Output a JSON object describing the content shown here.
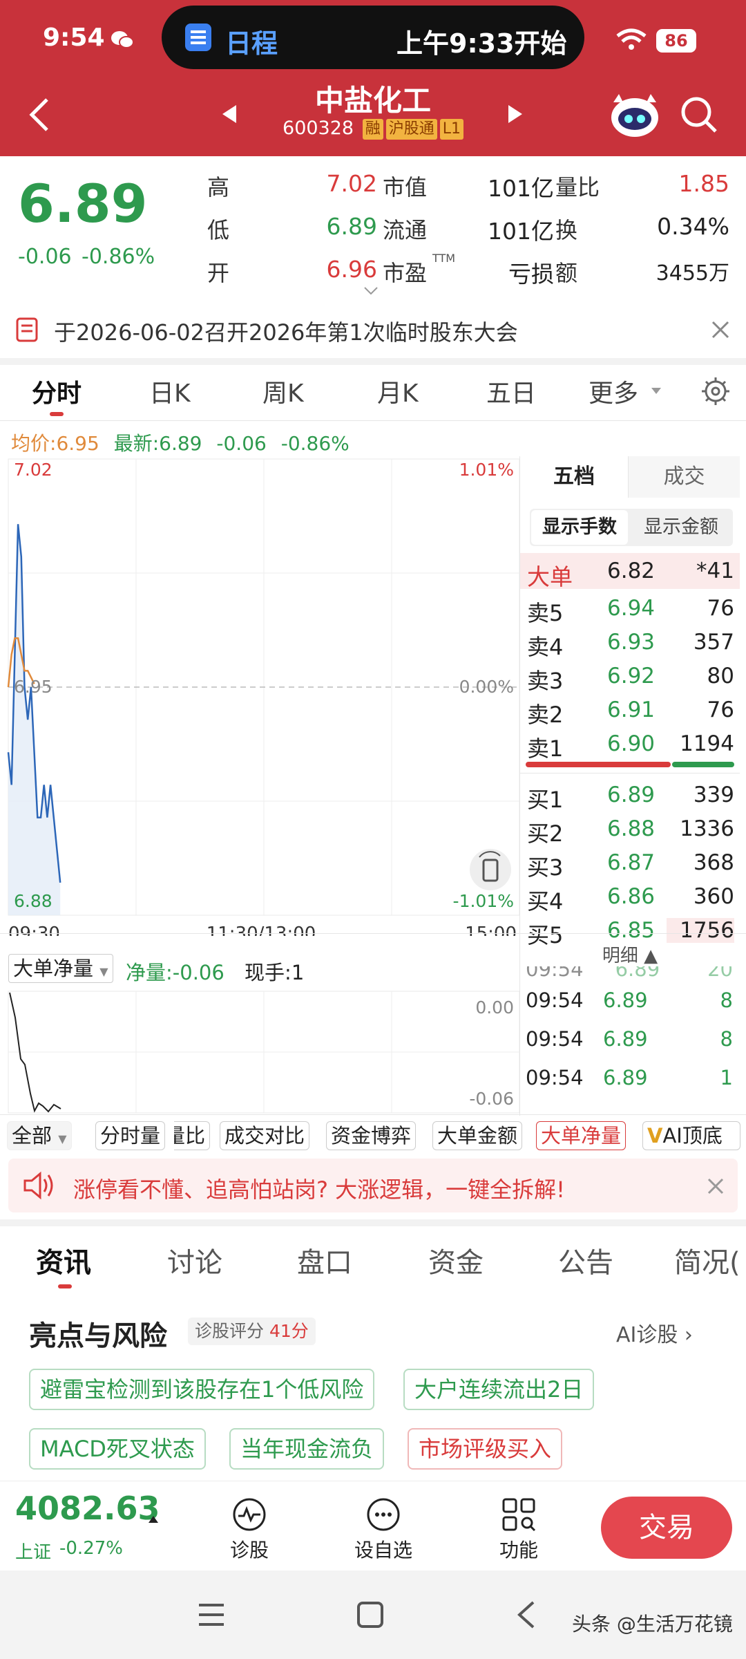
{
  "status_bar": {
    "time": "9:54",
    "island_label": "日程",
    "island_text": "上午9:33开始",
    "battery": "86"
  },
  "header": {
    "title": "中盐化工",
    "code": "600328",
    "tags": [
      "融",
      "沪股通",
      "L1"
    ]
  },
  "quote": {
    "price": "6.89",
    "change": "-0.06",
    "change_pct": "-0.86%",
    "rows": [
      {
        "l1": "高",
        "v1": "7.02",
        "l2": "市值",
        "v2": "101亿",
        "l3": "量比",
        "v3": "1.85"
      },
      {
        "l1": "低",
        "v1": "6.89",
        "l2": "流通",
        "v2": "101亿",
        "l3": "换",
        "v3": "0.34%"
      },
      {
        "l1": "开",
        "v1": "6.96",
        "l2": "市盈",
        "l2sup": "TTM",
        "v2": "亏损",
        "l3": "额",
        "v3": "3455万"
      }
    ]
  },
  "notice": {
    "text": "于2026-06-02召开2026年第1次临时股东大会"
  },
  "chart_tabs": [
    "分时",
    "日K",
    "周K",
    "月K",
    "五日",
    "更多"
  ],
  "chart_info": {
    "avg_label": "均价:",
    "avg": "6.95",
    "latest_label": "最新:",
    "latest": "6.89",
    "chg": "-0.06",
    "pct": "-0.86%"
  },
  "chart_data": {
    "type": "line",
    "y_top_label": "7.02",
    "y_mid_label": "6.95",
    "y_bottom_label": "6.88",
    "pct_top": "1.01%",
    "pct_mid": "0.00%",
    "pct_bottom": "-1.01%",
    "x_labels": [
      "09:30",
      "11:30/13:00",
      "15:00"
    ],
    "ylim": [
      6.88,
      7.02
    ],
    "series": [
      {
        "color": "#2c66b8",
        "values": [
          6.93,
          6.92,
          6.96,
          7.0,
          6.99,
          6.95,
          6.94,
          6.95,
          6.93,
          6.91,
          6.91,
          6.92,
          6.91,
          6.92,
          6.91,
          6.9,
          6.89
        ]
      },
      {
        "color": "#e08a3b",
        "values": [
          6.95,
          6.96,
          6.965,
          6.965,
          6.96,
          6.955,
          6.955,
          6.953,
          6.951
        ]
      }
    ]
  },
  "order_book": {
    "tabs": [
      "五档",
      "成交"
    ],
    "toggle": [
      "显示手数",
      "显示金额"
    ],
    "big": {
      "label": "大单",
      "price": "6.82",
      "vol": "*41"
    },
    "sells": [
      {
        "label": "卖5",
        "price": "6.94",
        "vol": "76"
      },
      {
        "label": "卖4",
        "price": "6.93",
        "vol": "357"
      },
      {
        "label": "卖3",
        "price": "6.92",
        "vol": "80"
      },
      {
        "label": "卖2",
        "price": "6.91",
        "vol": "76"
      },
      {
        "label": "卖1",
        "price": "6.90",
        "vol": "1194"
      }
    ],
    "buys": [
      {
        "label": "买1",
        "price": "6.89",
        "vol": "339"
      },
      {
        "label": "买2",
        "price": "6.88",
        "vol": "1336"
      },
      {
        "label": "买3",
        "price": "6.87",
        "vol": "368"
      },
      {
        "label": "买4",
        "price": "6.86",
        "vol": "360"
      },
      {
        "label": "买5",
        "price": "6.85",
        "vol": "1756"
      }
    ]
  },
  "sub_chart": {
    "select": "大单净量",
    "net_label": "净量:",
    "net": "-0.06",
    "hand_label": "现手:",
    "hand": "1",
    "top": "0.00",
    "bottom": "-0.06"
  },
  "detail": {
    "title": "明细",
    "rows": [
      {
        "t": "09:54",
        "p": "6.89",
        "v": "20"
      },
      {
        "t": "09:54",
        "p": "6.89",
        "v": "8"
      },
      {
        "t": "09:54",
        "p": "6.89",
        "v": "8"
      },
      {
        "t": "09:54",
        "p": "6.89",
        "v": "1"
      }
    ]
  },
  "indicator_chips": [
    "全部",
    "分时量",
    "量比",
    "成交对比",
    "资金博弈",
    "大单金额",
    "大单净量",
    "AI顶底"
  ],
  "promo": {
    "text": "涨停看不懂、追高怕站岗? 大涨逻辑，一键全拆解!"
  },
  "news_tabs": [
    "资讯",
    "讨论",
    "盘口",
    "资金",
    "公告",
    "简况("
  ],
  "highlights": {
    "title": "亮点与风险",
    "score_label": "诊股评分",
    "score": "41分",
    "ai": "AI诊股",
    "pills": [
      "避雷宝检测到该股存在1个低风险",
      "大户连续流出2日",
      "MACD死叉状态",
      "当年现金流负",
      "市场评级买入"
    ]
  },
  "bottom": {
    "index_value": "4082.63",
    "index_name": "上证",
    "index_pct": "-0.27%",
    "btn1": "诊股",
    "btn2": "设自选",
    "btn3": "功能",
    "trade": "交易"
  },
  "watermark": "头条 @生活万花镜"
}
